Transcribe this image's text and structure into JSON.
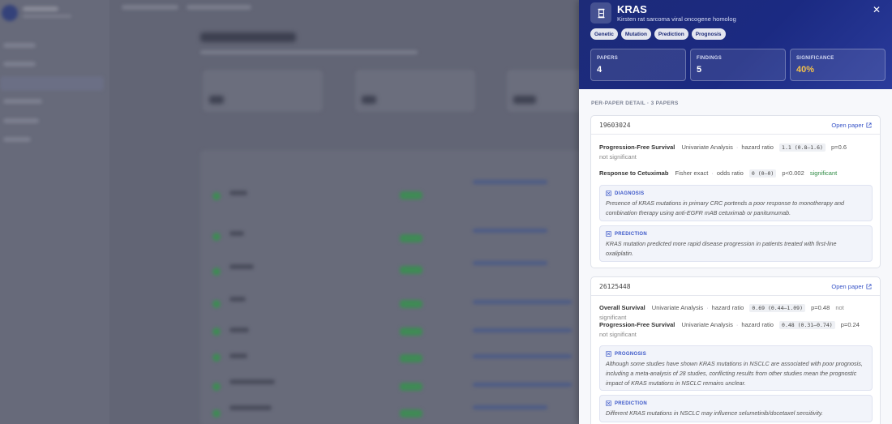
{
  "panel": {
    "gene_symbol": "KRAS",
    "gene_name": "Kirsten rat sarcoma viral oncogene homolog",
    "tags": [
      "Genetic",
      "Mutation",
      "Prediction",
      "Prognosis"
    ],
    "stats": [
      {
        "label": "PAPERS",
        "value": "4"
      },
      {
        "label": "FINDINGS",
        "value": "5"
      },
      {
        "label": "SIGNIFICANCE",
        "value": "40%"
      }
    ],
    "section_title": "PER-PAPER DETAIL · 3 PAPERS",
    "open_paper_label": "Open paper",
    "papers": [
      {
        "id": "19603024",
        "results": [
          {
            "outcome": "Progression-Free Survival",
            "method": "Univariate Analysis",
            "metric": "hazard ratio",
            "ci": "1.1 (0.8–1.6)",
            "p": "p=0.6",
            "significance": "not significant"
          },
          {
            "outcome": "Response to Cetuximab",
            "method": "Fisher exact",
            "metric": "odds ratio",
            "ci": "0 (0–0)",
            "p": "p<0.002",
            "significance": "significant"
          }
        ],
        "findings": [
          {
            "type": "DIAGNOSIS",
            "text": "Presence of KRAS mutations in primary CRC portends a poor response to monotherapy and combination therapy using anti-EGFR mAB cetuximab or panitumumab."
          },
          {
            "type": "PREDICTION",
            "text": "KRAS mutation predicted more rapid disease progression in patients treated with first-line oxaliplatin."
          }
        ]
      },
      {
        "id": "26125448",
        "results": [
          {
            "outcome": "Overall Survival",
            "method": "Univariate Analysis",
            "metric": "hazard ratio",
            "ci": "0.69 (0.44–1.09)",
            "p": "p=0.48",
            "significance": "not significant"
          },
          {
            "outcome": "Progression-Free Survival",
            "method": "Univariate Analysis",
            "metric": "hazard ratio",
            "ci": "0.48 (0.31–0.74)",
            "p": "p=0.24",
            "significance": "not significant"
          }
        ],
        "findings": [
          {
            "type": "PROGNOSIS",
            "text": "Although some studies have shown KRAS mutations in NSCLC are associated with poor prognosis, including a meta-analysis of 28 studies, conflicting results from other studies mean the prognostic impact of KRAS mutations in NSCLC remains unclear."
          },
          {
            "type": "PREDICTION",
            "text": "Different KRAS mutations in NSCLC may influence selumetinib/docetaxel sensitivity."
          }
        ]
      }
    ]
  },
  "colors": {
    "header_bg": "#1d2b78",
    "accent": "#3a56c8",
    "significant": "#2e8b44",
    "significance_value": "#f3c04b"
  },
  "icons": {
    "gene": "hourglass-icon",
    "close": "close-icon",
    "external": "external-link-icon",
    "finding": "sparkle-icon"
  }
}
